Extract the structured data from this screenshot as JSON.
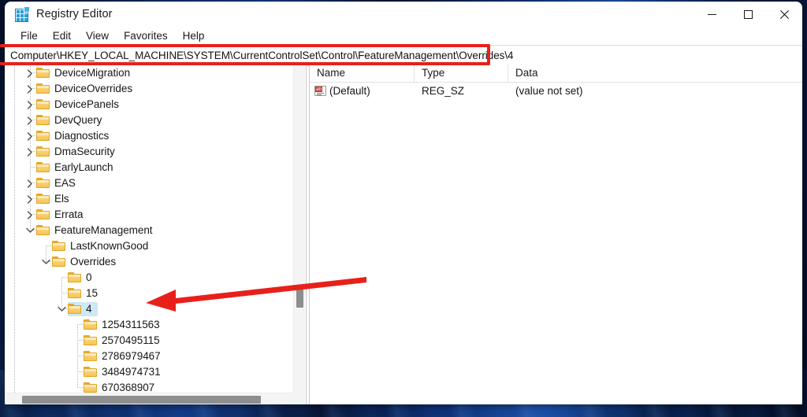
{
  "window": {
    "title": "Registry Editor",
    "app_icon": "registry-editor-icon",
    "controls": {
      "minimize": "minimize-icon",
      "maximize": "maximize-icon",
      "close": "close-icon"
    }
  },
  "menubar": {
    "items": [
      {
        "label": "File"
      },
      {
        "label": "Edit"
      },
      {
        "label": "View"
      },
      {
        "label": "Favorites"
      },
      {
        "label": "Help"
      }
    ]
  },
  "address": {
    "path": "Computer\\HKEY_LOCAL_MACHINE\\SYSTEM\\CurrentControlSet\\Control\\FeatureManagement\\Overrides\\4"
  },
  "annotations": {
    "highlight_box_color": "#e8201a",
    "arrow_color": "#e8201a",
    "arrow_points_to": "4"
  },
  "tree": {
    "nodes": [
      {
        "label": "DeviceMigration",
        "depth": 3,
        "twisty": "collapsed",
        "selected": false
      },
      {
        "label": "DeviceOverrides",
        "depth": 3,
        "twisty": "collapsed",
        "selected": false
      },
      {
        "label": "DevicePanels",
        "depth": 3,
        "twisty": "collapsed",
        "selected": false
      },
      {
        "label": "DevQuery",
        "depth": 3,
        "twisty": "collapsed",
        "selected": false
      },
      {
        "label": "Diagnostics",
        "depth": 3,
        "twisty": "collapsed",
        "selected": false
      },
      {
        "label": "DmaSecurity",
        "depth": 3,
        "twisty": "collapsed",
        "selected": false
      },
      {
        "label": "EarlyLaunch",
        "depth": 3,
        "twisty": "none",
        "selected": false
      },
      {
        "label": "EAS",
        "depth": 3,
        "twisty": "collapsed",
        "selected": false
      },
      {
        "label": "Els",
        "depth": 3,
        "twisty": "collapsed",
        "selected": false
      },
      {
        "label": "Errata",
        "depth": 3,
        "twisty": "collapsed",
        "selected": false
      },
      {
        "label": "FeatureManagement",
        "depth": 3,
        "twisty": "expanded",
        "selected": false
      },
      {
        "label": "LastKnownGood",
        "depth": 4,
        "twisty": "none",
        "selected": false
      },
      {
        "label": "Overrides",
        "depth": 4,
        "twisty": "expanded",
        "selected": false
      },
      {
        "label": "0",
        "depth": 5,
        "twisty": "none",
        "selected": false
      },
      {
        "label": "15",
        "depth": 5,
        "twisty": "none",
        "selected": false
      },
      {
        "label": "4",
        "depth": 5,
        "twisty": "expanded",
        "selected": true
      },
      {
        "label": "1254311563",
        "depth": 6,
        "twisty": "none",
        "selected": false
      },
      {
        "label": "2570495115",
        "depth": 6,
        "twisty": "none",
        "selected": false
      },
      {
        "label": "2786979467",
        "depth": 6,
        "twisty": "none",
        "selected": false
      },
      {
        "label": "3484974731",
        "depth": 6,
        "twisty": "none",
        "selected": false
      },
      {
        "label": "670368907",
        "depth": 6,
        "twisty": "none",
        "selected": false
      }
    ]
  },
  "list": {
    "columns": [
      {
        "label": "Name"
      },
      {
        "label": "Type"
      },
      {
        "label": "Data"
      }
    ],
    "rows": [
      {
        "icon": "string-value-icon",
        "name": "(Default)",
        "type": "REG_SZ",
        "data": "(value not set)"
      }
    ]
  }
}
